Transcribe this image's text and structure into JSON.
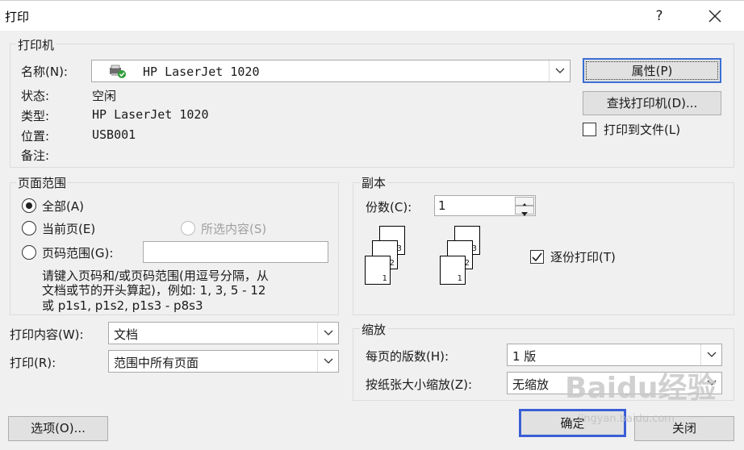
{
  "window": {
    "title": "打印",
    "help": "?"
  },
  "printer": {
    "group_label": "打印机",
    "name_label": "名称(N):",
    "name_value": "HP LaserJet 1020",
    "status_label": "状态:",
    "status_value": "空闲",
    "type_label": "类型:",
    "type_value": "HP LaserJet 1020",
    "where_label": "位置:",
    "where_value": "USB001",
    "comment_label": "备注:",
    "properties_button": "属性(P)",
    "find_button": "查找打印机(D)...",
    "print_to_file": "打印到文件(L)"
  },
  "range": {
    "group_label": "页面范围",
    "all": "全部(A)",
    "current": "当前页(E)",
    "selection": "所选内容(S)",
    "pages": "页码范围(G):",
    "pages_value": "",
    "help_line1": "请键入页码和/或页码范围(用逗号分隔，从",
    "help_line2": "文档或节的开头算起)，例如: 1, 3, 5 - 12",
    "help_line3": "或 p1s1, p1s2, p1s3 - p8s3"
  },
  "copies": {
    "group_label": "副本",
    "count_label": "份数(C):",
    "count_value": "1",
    "collate": "逐份打印(T)"
  },
  "print_what": {
    "label": "打印内容(W):",
    "value": "文档"
  },
  "print_mode": {
    "label": "打印(R):",
    "value": "范围中所有页面"
  },
  "zoom": {
    "group_label": "缩放",
    "pages_per_sheet_label": "每页的版数(H):",
    "pages_per_sheet_value": "1 版",
    "scale_label": "按纸张大小缩放(Z):",
    "scale_value": "无缩放"
  },
  "footer": {
    "options_button": "选项(O)...",
    "ok_button": "确定",
    "close_button": "关闭"
  },
  "watermark": {
    "text": "Baidu经验",
    "sub": "jingyan.baidu.com"
  },
  "colors": {
    "focus_blue": "#3b5fd6",
    "printer_check": "#2e9e3a"
  }
}
